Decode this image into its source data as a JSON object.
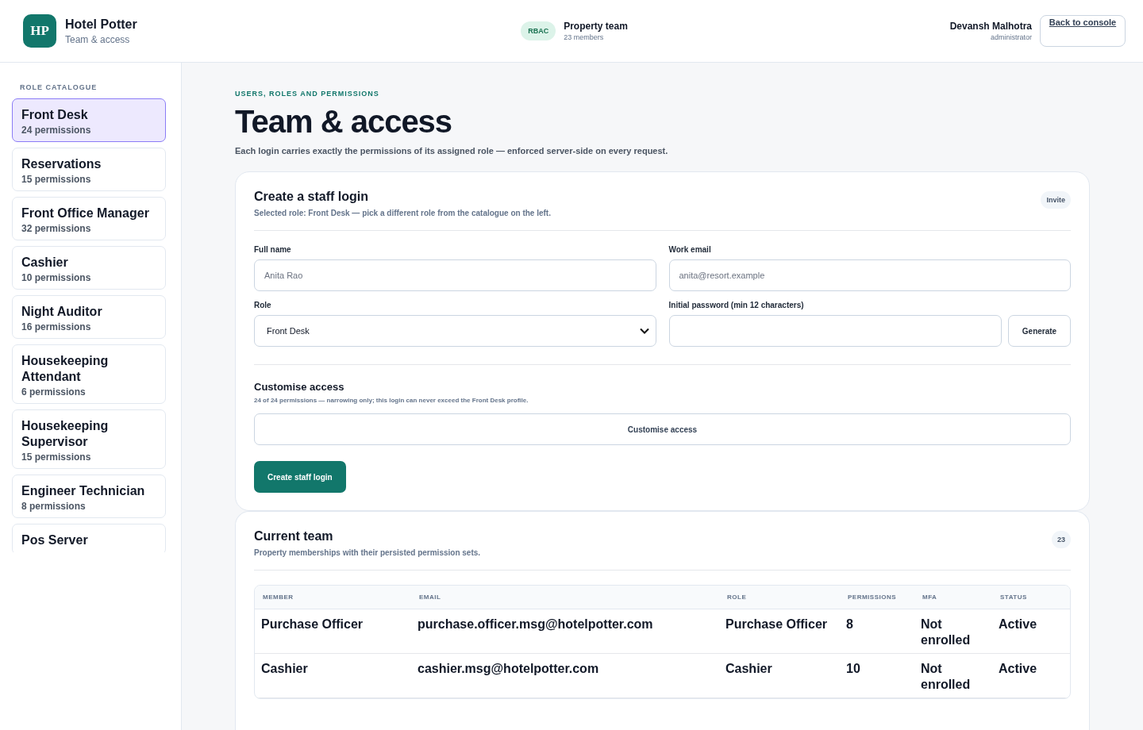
{
  "header": {
    "logo": "HP",
    "title": "Hotel Potter",
    "subtitle": "Team & access",
    "badge": "RBAC",
    "team": {
      "name": "Property team",
      "count": "23 members"
    },
    "user": {
      "name": "Devansh Malhotra",
      "role": "administrator"
    },
    "back_link": "Back to console"
  },
  "sidebar": {
    "heading": "ROLE CATALOGUE",
    "items": [
      {
        "name": "Front Desk",
        "count": "24 permissions",
        "selected": true
      },
      {
        "name": "Reservations",
        "count": "15 permissions",
        "selected": false
      },
      {
        "name": "Front Office Manager",
        "count": "32 permissions",
        "selected": false
      },
      {
        "name": "Cashier",
        "count": "10 permissions",
        "selected": false
      },
      {
        "name": "Night Auditor",
        "count": "16 permissions",
        "selected": false
      },
      {
        "name": "Housekeeping Attendant",
        "count": "6 permissions",
        "selected": false
      },
      {
        "name": "Housekeeping Supervisor",
        "count": "15 permissions",
        "selected": false
      },
      {
        "name": "Engineer Technician",
        "count": "8 permissions",
        "selected": false
      },
      {
        "name": "Pos Server",
        "selected": false
      }
    ]
  },
  "page": {
    "eyebrow": "USERS, ROLES AND PERMISSIONS",
    "title": "Team & access",
    "description": "Each login carries exactly the permissions of its assigned role — enforced server-side on every request."
  },
  "create_form": {
    "title": "Create a staff login",
    "subtitle": "Selected role: Front Desk — pick a different role from the catalogue on the left.",
    "tag": "Invite",
    "full_name": {
      "label": "Full name",
      "placeholder": "Anita Rao"
    },
    "work_email": {
      "label": "Work email",
      "placeholder": "anita@resort.example"
    },
    "role": {
      "label": "Role",
      "value": "Front Desk"
    },
    "password": {
      "label": "Initial password (min 12 characters)",
      "button": "Generate"
    },
    "customise": {
      "title": "Customise access",
      "note": "24 of 24 permissions — narrowing only; this login can never exceed the Front Desk profile.",
      "button": "Customise access"
    },
    "submit": "Create staff login"
  },
  "team": {
    "title": "Current team",
    "subtitle": "Property memberships with their persisted permission sets.",
    "count": "23",
    "table": {
      "columns": [
        "MEMBER",
        "EMAIL",
        "ROLE",
        "PERMISSIONS",
        "MFA",
        "STATUS"
      ],
      "rows": [
        [
          "Purchase Officer",
          "purchase.officer.msg@hotelpotter.com",
          "Purchase Officer",
          "8",
          "Not enrolled",
          "Active"
        ],
        [
          "Cashier",
          "cashier.msg@hotelpotter.com",
          "Cashier",
          "10",
          "Not enrolled",
          "Active"
        ]
      ]
    }
  }
}
